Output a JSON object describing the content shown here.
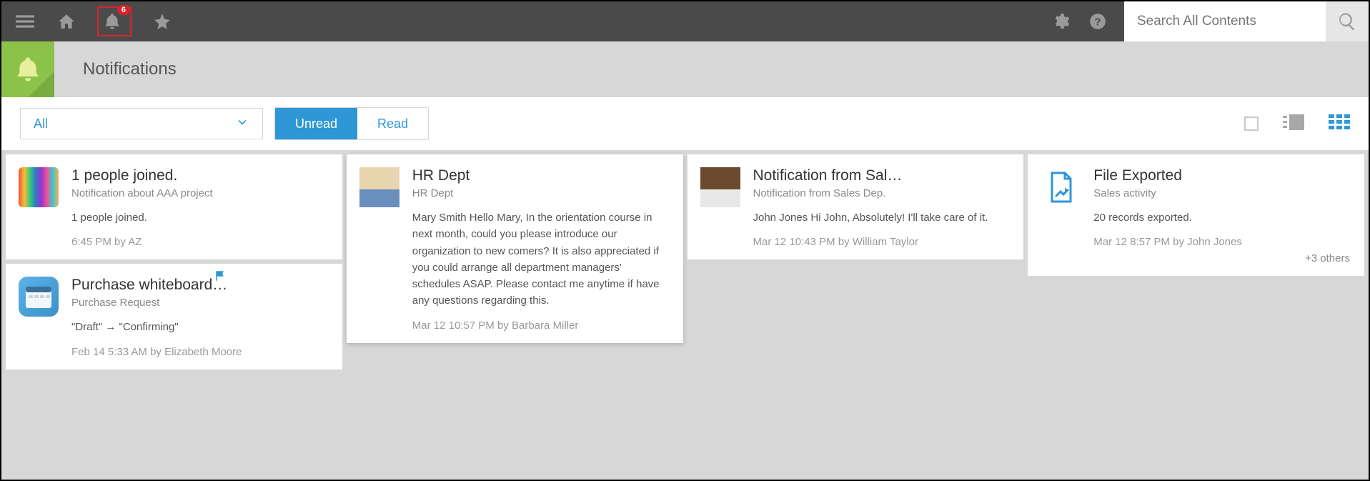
{
  "header": {
    "badge_count": "6",
    "search_placeholder": "Search All Contents"
  },
  "page": {
    "title": "Notifications"
  },
  "filter": {
    "select_label": "All",
    "unread_label": "Unread",
    "read_label": "Read"
  },
  "cards": {
    "c1": {
      "title": "1 people joined.",
      "sub": "Notification about AAA project",
      "text": "1 people joined.",
      "meta": "6:45 PM  by AZ"
    },
    "c2": {
      "title": "Purchase whiteboard…",
      "sub": "Purchase Request",
      "text": "\"Draft\" → \"Confirming\"",
      "meta": "Feb 14 5:33 AM  by Elizabeth Moore"
    },
    "c3": {
      "title": "HR Dept",
      "sub": "HR Dept",
      "text": "Mary Smith Hello Mary, In the orientation course in next month, could you please introduce our organization to new comers? It is also appreciated if you could arrange all department managers' schedules ASAP. Please contact me anytime if have any questions regarding this.",
      "meta": "Mar 12 10:57 PM  by Barbara Miller"
    },
    "c4": {
      "title": "Notification from Sal…",
      "sub": "Notification from Sales Dep.",
      "text": "John Jones Hi John, Absolutely! I'll take care of it.",
      "meta": "Mar 12 10:43 PM  by William Taylor"
    },
    "c5": {
      "title": "File Exported",
      "sub": "Sales activity",
      "text": "20 records exported.",
      "meta": "Mar 12 8:57 PM  by John Jones",
      "others": "+3 others"
    }
  }
}
